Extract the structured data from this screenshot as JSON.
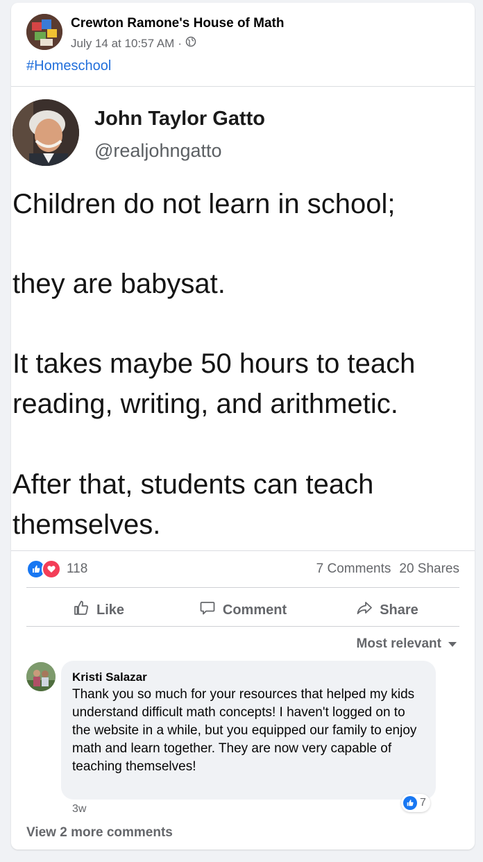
{
  "post": {
    "page_name": "Crewton Ramone's House of Math",
    "timestamp": "July 14 at 10:57 AM",
    "separator": "·",
    "privacy_icon": "globe-icon",
    "hashtag": "#Homeschool"
  },
  "tweet": {
    "name": "John Taylor Gatto",
    "handle": "@realjohngatto",
    "lines": [
      "Children do not learn in school;",
      "they are babysat.",
      "It takes maybe 50 hours to teach",
      "reading, writing, and arithmetic.",
      "After that, students can teach",
      "themselves."
    ]
  },
  "stats": {
    "reaction_icons": [
      "like-icon",
      "love-icon"
    ],
    "reaction_count": "118",
    "comments": "7 Comments",
    "shares": "20 Shares"
  },
  "actions": {
    "like": "Like",
    "comment": "Comment",
    "share": "Share"
  },
  "comments_section": {
    "sort_label": "Most relevant",
    "comment": {
      "author": "Kristi Salazar",
      "text": "Thank you so much for your resources that helped my kids understand difficult math concepts! I haven't logged on to the website in a while, but you equipped our family to enjoy math and learn together. They are now very capable of teaching themselves!",
      "time": "3w",
      "reaction_count": "7"
    },
    "view_more": "View 2 more comments"
  },
  "colors": {
    "like_blue": "#1877f2",
    "love_red": "#f33e58",
    "link_blue": "#216fdb",
    "secondary_text": "#65676b"
  }
}
